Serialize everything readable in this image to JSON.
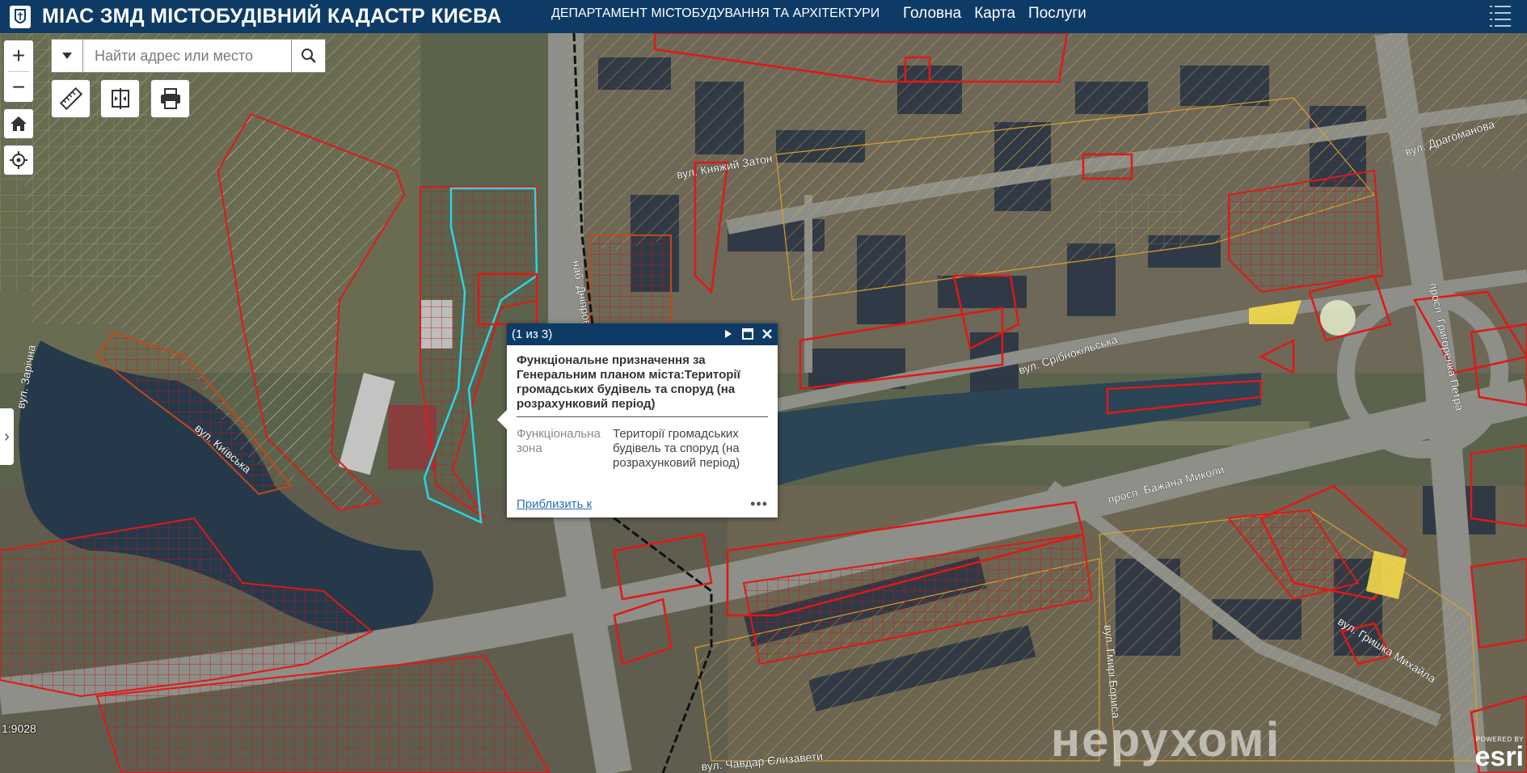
{
  "header": {
    "title": "МІАС ЗМД МІСТОБУДІВНИЙ КАДАСТР КИЄВА",
    "department": "ДЕПАРТАМЕНТ МІСТОБУДУВАННЯ ТА АРХІТЕКТУРИ",
    "nav": [
      "Головна",
      "Карта",
      "Послуги"
    ]
  },
  "search": {
    "placeholder": "Найти адрес или место"
  },
  "controls": {
    "zoom_in": "+",
    "zoom_out": "−",
    "icons": [
      "measure-icon",
      "swipe-icon",
      "print-icon",
      "home-icon",
      "locate-icon"
    ]
  },
  "popup": {
    "count": "(1 из 3)",
    "title": "Функціональне призначення за Генеральним планом міста:Території громадських будівель та споруд (на розрахунковий період)",
    "field_label": "Функціональна зона",
    "field_value": "Території громадських будівель та споруд (на розрахунковий період)",
    "zoom_link": "Приблизить к",
    "more": "•••"
  },
  "streets": [
    "вул. Княжий Затон",
    "вул. Драгоманова",
    "наб. Дніпровська",
    "вул. Срібнокільська",
    "просп. Бажана Миколи",
    "просп. Григоренка Петра",
    "вул. Гмирі Бориса",
    "вул. Гришка Михайла",
    "вул. Чавдар Єлизавети",
    "вул. Київська",
    "вул. Зарічна"
  ],
  "scale": "1:9028",
  "watermark": "нерухомі",
  "attribution": {
    "powered": "POWERED BY",
    "name": "esri"
  },
  "colors": {
    "header": "#0d3b66",
    "parcel_red": "#e01818",
    "parcel_orange": "#d9a030",
    "highlight": "#27d7e6"
  }
}
